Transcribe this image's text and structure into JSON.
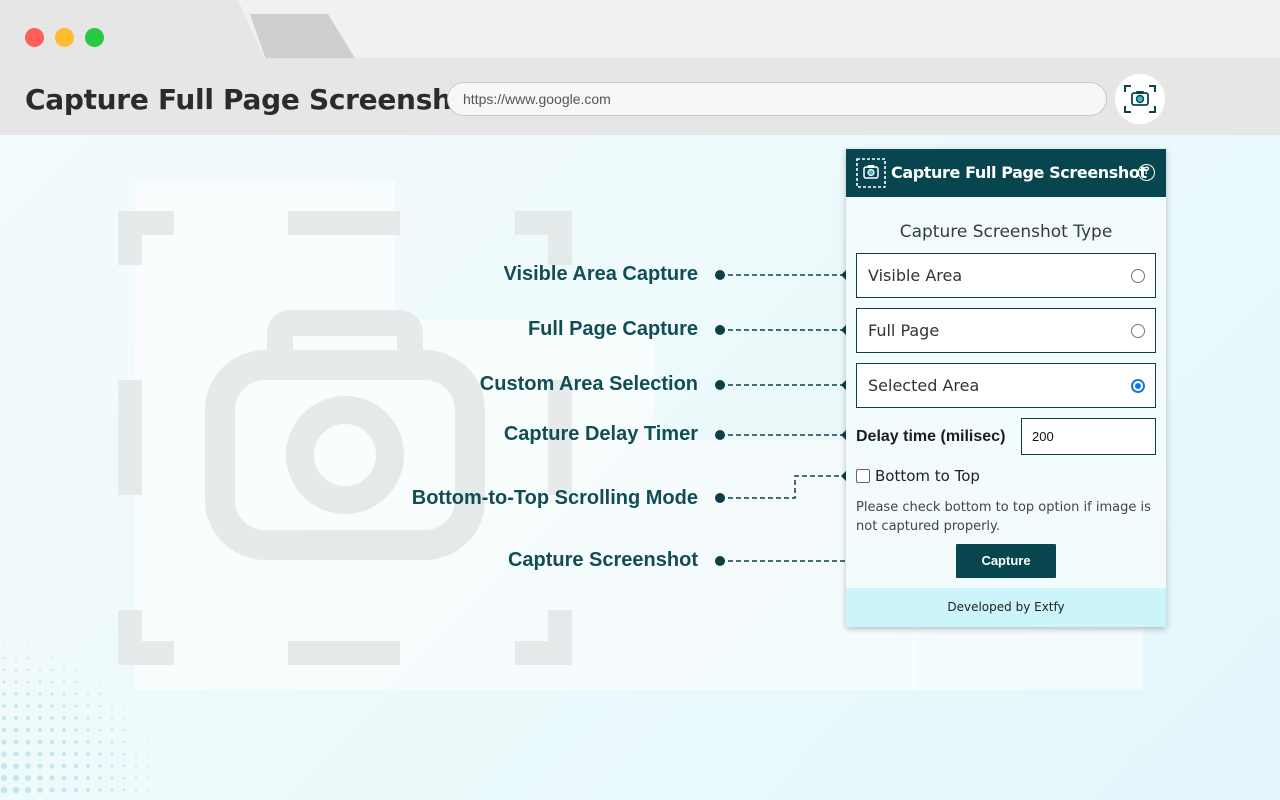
{
  "browser": {
    "app_title": "Capture Full Page Screenshot",
    "url": "https://www.google.com",
    "extension_icon": "camera-capture-icon"
  },
  "features": [
    {
      "label": "Visible Area Capture"
    },
    {
      "label": "Full Page Capture"
    },
    {
      "label": "Custom Area Selection"
    },
    {
      "label": "Capture Delay Timer"
    },
    {
      "label": "Bottom-to-Top Scrolling Mode"
    },
    {
      "label": "Capture Screenshot"
    }
  ],
  "popup": {
    "title": "Capture Full Page Screenshot",
    "help_icon": "?",
    "section_title": "Capture Screenshot Type",
    "options": [
      {
        "label": "Visible Area",
        "checked": false
      },
      {
        "label": "Full Page",
        "checked": false
      },
      {
        "label": "Selected Area",
        "checked": true
      }
    ],
    "delay_label": "Delay time (milisec)",
    "delay_value": "200",
    "bottom_to_top_label": "Bottom to Top",
    "bottom_to_top_checked": false,
    "help_text": "Please check bottom to top option if image is not captured properly.",
    "capture_label": "Capture",
    "footer": "Developed by Extfy"
  },
  "colors": {
    "brand": "#07464f",
    "label_text": "#124d56",
    "footer_bg": "#ccf4fb",
    "radio_selected": "#1a73e8"
  }
}
